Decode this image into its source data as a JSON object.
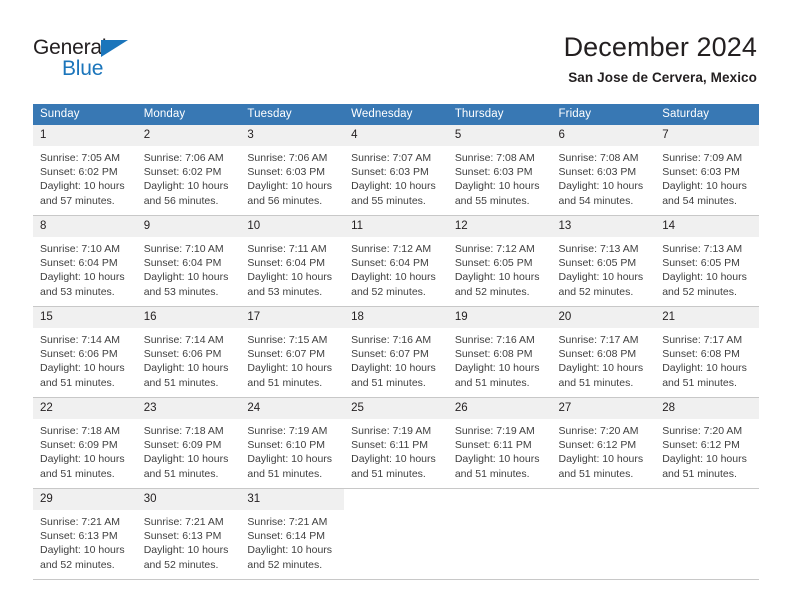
{
  "brand": {
    "name_part1": "General",
    "name_part2": "Blue",
    "color_primary": "#1b75bb",
    "color_text": "#231f20",
    "triangle_icon": "triangle-icon"
  },
  "header": {
    "title": "December 2024",
    "subtitle": "San Jose de Cervera, Mexico"
  },
  "calendar": {
    "header_bg": "#3878b4",
    "daynum_bg": "#f0f0f0",
    "weekday_labels": [
      "Sunday",
      "Monday",
      "Tuesday",
      "Wednesday",
      "Thursday",
      "Friday",
      "Saturday"
    ],
    "weeks": [
      [
        {
          "day": "1",
          "sunrise": "Sunrise: 7:05 AM",
          "sunset": "Sunset: 6:02 PM",
          "daylight1": "Daylight: 10 hours",
          "daylight2": "and 57 minutes."
        },
        {
          "day": "2",
          "sunrise": "Sunrise: 7:06 AM",
          "sunset": "Sunset: 6:02 PM",
          "daylight1": "Daylight: 10 hours",
          "daylight2": "and 56 minutes."
        },
        {
          "day": "3",
          "sunrise": "Sunrise: 7:06 AM",
          "sunset": "Sunset: 6:03 PM",
          "daylight1": "Daylight: 10 hours",
          "daylight2": "and 56 minutes."
        },
        {
          "day": "4",
          "sunrise": "Sunrise: 7:07 AM",
          "sunset": "Sunset: 6:03 PM",
          "daylight1": "Daylight: 10 hours",
          "daylight2": "and 55 minutes."
        },
        {
          "day": "5",
          "sunrise": "Sunrise: 7:08 AM",
          "sunset": "Sunset: 6:03 PM",
          "daylight1": "Daylight: 10 hours",
          "daylight2": "and 55 minutes."
        },
        {
          "day": "6",
          "sunrise": "Sunrise: 7:08 AM",
          "sunset": "Sunset: 6:03 PM",
          "daylight1": "Daylight: 10 hours",
          "daylight2": "and 54 minutes."
        },
        {
          "day": "7",
          "sunrise": "Sunrise: 7:09 AM",
          "sunset": "Sunset: 6:03 PM",
          "daylight1": "Daylight: 10 hours",
          "daylight2": "and 54 minutes."
        }
      ],
      [
        {
          "day": "8",
          "sunrise": "Sunrise: 7:10 AM",
          "sunset": "Sunset: 6:04 PM",
          "daylight1": "Daylight: 10 hours",
          "daylight2": "and 53 minutes."
        },
        {
          "day": "9",
          "sunrise": "Sunrise: 7:10 AM",
          "sunset": "Sunset: 6:04 PM",
          "daylight1": "Daylight: 10 hours",
          "daylight2": "and 53 minutes."
        },
        {
          "day": "10",
          "sunrise": "Sunrise: 7:11 AM",
          "sunset": "Sunset: 6:04 PM",
          "daylight1": "Daylight: 10 hours",
          "daylight2": "and 53 minutes."
        },
        {
          "day": "11",
          "sunrise": "Sunrise: 7:12 AM",
          "sunset": "Sunset: 6:04 PM",
          "daylight1": "Daylight: 10 hours",
          "daylight2": "and 52 minutes."
        },
        {
          "day": "12",
          "sunrise": "Sunrise: 7:12 AM",
          "sunset": "Sunset: 6:05 PM",
          "daylight1": "Daylight: 10 hours",
          "daylight2": "and 52 minutes."
        },
        {
          "day": "13",
          "sunrise": "Sunrise: 7:13 AM",
          "sunset": "Sunset: 6:05 PM",
          "daylight1": "Daylight: 10 hours",
          "daylight2": "and 52 minutes."
        },
        {
          "day": "14",
          "sunrise": "Sunrise: 7:13 AM",
          "sunset": "Sunset: 6:05 PM",
          "daylight1": "Daylight: 10 hours",
          "daylight2": "and 52 minutes."
        }
      ],
      [
        {
          "day": "15",
          "sunrise": "Sunrise: 7:14 AM",
          "sunset": "Sunset: 6:06 PM",
          "daylight1": "Daylight: 10 hours",
          "daylight2": "and 51 minutes."
        },
        {
          "day": "16",
          "sunrise": "Sunrise: 7:14 AM",
          "sunset": "Sunset: 6:06 PM",
          "daylight1": "Daylight: 10 hours",
          "daylight2": "and 51 minutes."
        },
        {
          "day": "17",
          "sunrise": "Sunrise: 7:15 AM",
          "sunset": "Sunset: 6:07 PM",
          "daylight1": "Daylight: 10 hours",
          "daylight2": "and 51 minutes."
        },
        {
          "day": "18",
          "sunrise": "Sunrise: 7:16 AM",
          "sunset": "Sunset: 6:07 PM",
          "daylight1": "Daylight: 10 hours",
          "daylight2": "and 51 minutes."
        },
        {
          "day": "19",
          "sunrise": "Sunrise: 7:16 AM",
          "sunset": "Sunset: 6:08 PM",
          "daylight1": "Daylight: 10 hours",
          "daylight2": "and 51 minutes."
        },
        {
          "day": "20",
          "sunrise": "Sunrise: 7:17 AM",
          "sunset": "Sunset: 6:08 PM",
          "daylight1": "Daylight: 10 hours",
          "daylight2": "and 51 minutes."
        },
        {
          "day": "21",
          "sunrise": "Sunrise: 7:17 AM",
          "sunset": "Sunset: 6:08 PM",
          "daylight1": "Daylight: 10 hours",
          "daylight2": "and 51 minutes."
        }
      ],
      [
        {
          "day": "22",
          "sunrise": "Sunrise: 7:18 AM",
          "sunset": "Sunset: 6:09 PM",
          "daylight1": "Daylight: 10 hours",
          "daylight2": "and 51 minutes."
        },
        {
          "day": "23",
          "sunrise": "Sunrise: 7:18 AM",
          "sunset": "Sunset: 6:09 PM",
          "daylight1": "Daylight: 10 hours",
          "daylight2": "and 51 minutes."
        },
        {
          "day": "24",
          "sunrise": "Sunrise: 7:19 AM",
          "sunset": "Sunset: 6:10 PM",
          "daylight1": "Daylight: 10 hours",
          "daylight2": "and 51 minutes."
        },
        {
          "day": "25",
          "sunrise": "Sunrise: 7:19 AM",
          "sunset": "Sunset: 6:11 PM",
          "daylight1": "Daylight: 10 hours",
          "daylight2": "and 51 minutes."
        },
        {
          "day": "26",
          "sunrise": "Sunrise: 7:19 AM",
          "sunset": "Sunset: 6:11 PM",
          "daylight1": "Daylight: 10 hours",
          "daylight2": "and 51 minutes."
        },
        {
          "day": "27",
          "sunrise": "Sunrise: 7:20 AM",
          "sunset": "Sunset: 6:12 PM",
          "daylight1": "Daylight: 10 hours",
          "daylight2": "and 51 minutes."
        },
        {
          "day": "28",
          "sunrise": "Sunrise: 7:20 AM",
          "sunset": "Sunset: 6:12 PM",
          "daylight1": "Daylight: 10 hours",
          "daylight2": "and 51 minutes."
        }
      ],
      [
        {
          "day": "29",
          "sunrise": "Sunrise: 7:21 AM",
          "sunset": "Sunset: 6:13 PM",
          "daylight1": "Daylight: 10 hours",
          "daylight2": "and 52 minutes."
        },
        {
          "day": "30",
          "sunrise": "Sunrise: 7:21 AM",
          "sunset": "Sunset: 6:13 PM",
          "daylight1": "Daylight: 10 hours",
          "daylight2": "and 52 minutes."
        },
        {
          "day": "31",
          "sunrise": "Sunrise: 7:21 AM",
          "sunset": "Sunset: 6:14 PM",
          "daylight1": "Daylight: 10 hours",
          "daylight2": "and 52 minutes."
        },
        {
          "day": "",
          "sunrise": "",
          "sunset": "",
          "daylight1": "",
          "daylight2": ""
        },
        {
          "day": "",
          "sunrise": "",
          "sunset": "",
          "daylight1": "",
          "daylight2": ""
        },
        {
          "day": "",
          "sunrise": "",
          "sunset": "",
          "daylight1": "",
          "daylight2": ""
        },
        {
          "day": "",
          "sunrise": "",
          "sunset": "",
          "daylight1": "",
          "daylight2": ""
        }
      ]
    ]
  }
}
